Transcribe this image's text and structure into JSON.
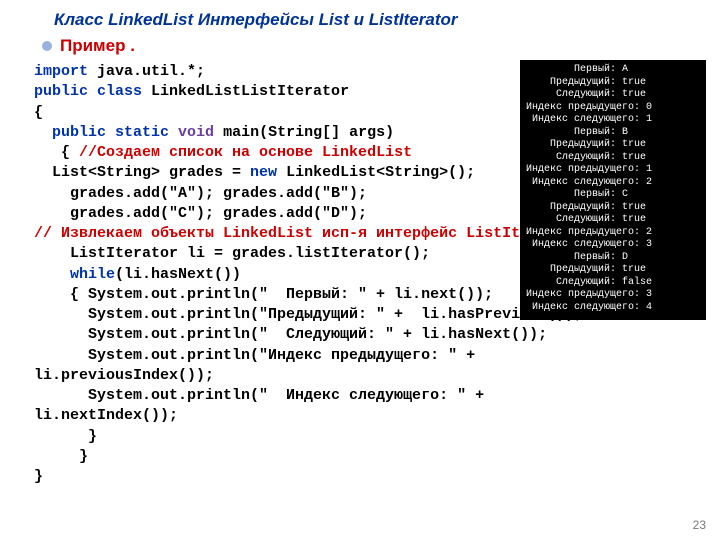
{
  "title": "Класс LinkedList   Интерфейсы List и ListIterator",
  "subtitle": "Пример .",
  "page_number": "23",
  "code": {
    "l1_kw": "import",
    "l1_r": " java.util.*;",
    "l2_kw": "public class",
    "l2_r": " LinkedListListIterator",
    "l3": "{",
    "l4_pad": "  ",
    "l4_kw": "public static ",
    "l4_vd": "void",
    "l4_r": " main(String[] args)",
    "l5_pad": "   { ",
    "l5_cm": "//Создаем список на основе LinkedList",
    "l6_a": "  List<String> grades = ",
    "l6_kw": "new",
    "l6_b": " LinkedList<String>();",
    "l7": "    grades.add(\"A\"); grades.add(\"B\");",
    "l8": "    grades.add(\"C\"); grades.add(\"D\");",
    "l9_cm": "// Извлекаем объекты LinkedList исп-я интерфейс ListIterator",
    "l10": "    ListIterator li = grades.listIterator();",
    "l11_pad": "    ",
    "l11_kw": "while",
    "l11_r": "(li.hasNext())",
    "l12": "    { System.out.println(\"  Первый: \" + li.next());",
    "l13": "      System.out.println(\"Предыдущий: \" +  li.hasPrevious());",
    "l14": "      System.out.println(\"  Следующий: \" + li.hasNext());",
    "l15a": "      System.out.println(\"Индекс предыдущего: \" +",
    "l15b": "li.previousIndex());",
    "l16a": "      System.out.println(\"  Индекс следующего: \" +",
    "l16b": "li.nextIndex());",
    "l17": "      }",
    "l18": "     }",
    "l19": "}"
  },
  "console": "        Первый: A\n    Предыдущий: true\n     Слeдующий: true\nИндекс предыдущего: 0\n Индекс слeдующего: 1\n        Первый: B\n    Предыдущий: true\n     Слeдующий: true\nИндекс предыдущего: 1\n Индекс слeдующего: 2\n        Первый: C\n    Предыдущий: true\n     Слeдующий: true\nИндекс предыдущего: 2\n Индекс слeдующего: 3\n        Первый: D\n    Предыдущий: true\n     Слeдующий: false\nИндекс предыдущего: 3\n Индекс слeдующего: 4"
}
